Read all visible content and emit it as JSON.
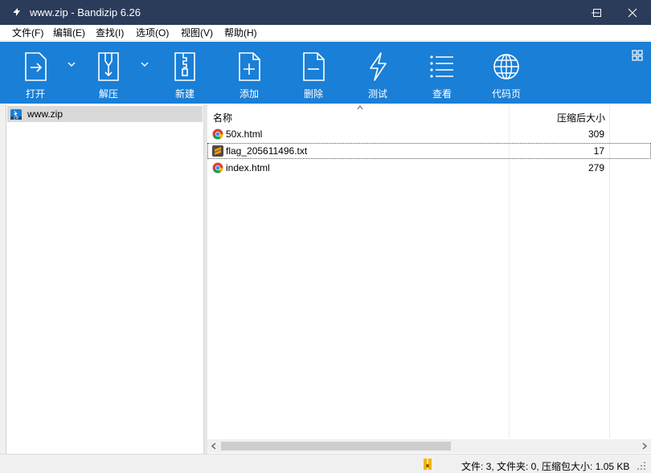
{
  "window": {
    "title": "www.zip - Bandizip 6.26",
    "colors": {
      "titlebar": "#2b3b5a",
      "toolbar": "#1a7fd6",
      "selection": "#d9d9d9"
    }
  },
  "menu": [
    "文件(F)",
    "编辑(E)",
    "查找(I)",
    "选项(O)",
    "视图(V)",
    "帮助(H)"
  ],
  "toolbar": [
    {
      "label": "打开",
      "icon": "open-file-icon"
    },
    {
      "label": "解压",
      "icon": "extract-icon"
    },
    {
      "label": "新建",
      "icon": "new-archive-icon"
    },
    {
      "label": "添加",
      "icon": "add-file-icon"
    },
    {
      "label": "删除",
      "icon": "delete-file-icon"
    },
    {
      "label": "测试",
      "icon": "test-lightning-icon"
    },
    {
      "label": "查看",
      "icon": "view-list-icon"
    },
    {
      "label": "代码页",
      "icon": "codepage-globe-icon"
    }
  ],
  "tree": {
    "item": "www.zip"
  },
  "columns": {
    "name": "名称",
    "size": "压缩后大小"
  },
  "files": [
    {
      "name": "50x.html",
      "size": "309",
      "icon": "chrome-html-icon"
    },
    {
      "name": "flag_205611496.txt",
      "size": "17",
      "icon": "sublime-text-icon"
    },
    {
      "name": "index.html",
      "size": "279",
      "icon": "chrome-html-icon"
    }
  ],
  "status": {
    "text": "文件: 3, 文件夹: 0, 压缩包大小: 1.05 KB"
  }
}
